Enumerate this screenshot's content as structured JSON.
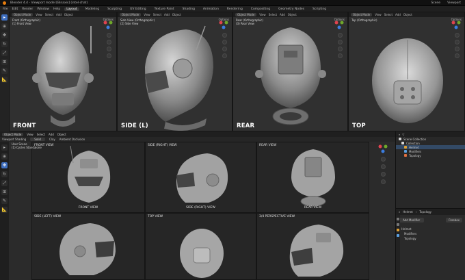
{
  "titlebar": {
    "text": "Blender 4.4 - Viewport model [Binaxis] (intel-chat)",
    "scene_label": "Scene",
    "viewport_label": "Viewport"
  },
  "menubar": {
    "items": [
      "File",
      "Edit",
      "Render",
      "Window",
      "Help"
    ],
    "workspaces": [
      "Layout",
      "Modeling",
      "Sculpting",
      "UV Editing",
      "Texture Paint",
      "Shading",
      "Animation",
      "Rendering",
      "Compositing",
      "Geometry Nodes",
      "Scripting"
    ]
  },
  "viewports": [
    {
      "mode": "Object Mode",
      "menus": [
        "View",
        "Select",
        "Add",
        "Object"
      ],
      "info1": "Front (Orthographic)",
      "info2": "(1) Front View",
      "label": "FRONT",
      "options": "Options"
    },
    {
      "mode": "Object Mode",
      "menus": [
        "View",
        "Select",
        "Add",
        "Object"
      ],
      "info1": "Side View (Orthographic)",
      "info2": "(2) Side View",
      "label": "SIDE (L)",
      "options": "Options"
    },
    {
      "mode": "Object Mode",
      "menus": [
        "View",
        "Select",
        "Add",
        "Object"
      ],
      "info1": "Rear (Orthographic)",
      "info2": "(3) Rear View",
      "label": "REAR",
      "options": "Options"
    },
    {
      "mode": "Object Mode",
      "menus": [
        "View",
        "Select",
        "Add",
        "Object"
      ],
      "info1": "Top (Orthographic)",
      "info2": "",
      "label": "TOP",
      "options": "Options"
    }
  ],
  "bottom": {
    "header_mode": "Object Mode",
    "header_menus": [
      "View",
      "Select",
      "Add",
      "Object"
    ],
    "shading_label": "Viewport Shading",
    "shading_value": "Solid",
    "clay_label": "Clay",
    "ao_label": "Ambient Occlusion",
    "info1": "User Scene",
    "info2": "(1) Cycles Standalone",
    "cells": [
      {
        "top": "FRONT VIEW",
        "bottom": "FRONT VIEW"
      },
      {
        "top": "SIDE (RIGHT) VIEW",
        "bottom": "SIDE (RIGHT) VIEW"
      },
      {
        "top": "REAR VIEW",
        "bottom": "REAR VIEW"
      },
      {
        "top": "SIDE (LEFT) VIEW",
        "bottom": ""
      },
      {
        "top": "TOP VIEW",
        "bottom": ""
      },
      {
        "top": "3/4 PERSPECTIVE VIEW",
        "bottom": ""
      }
    ]
  },
  "outliner": {
    "title": "Scene Collection",
    "items": [
      {
        "label": "Collection",
        "color": "#d8d8d8"
      },
      {
        "label": "Helmet",
        "color": "#e0a030"
      },
      {
        "label": "Modifiers",
        "color": "#5ba0e0"
      },
      {
        "label": "Topology",
        "color": "#e07040"
      }
    ]
  },
  "properties": {
    "object_name": "Helmet",
    "mod_name": "Topology",
    "add_modifier": "Add Modifier",
    "tab": "Freebox",
    "tree": [
      "Helmet",
      "Modifiers",
      "Topology"
    ]
  }
}
